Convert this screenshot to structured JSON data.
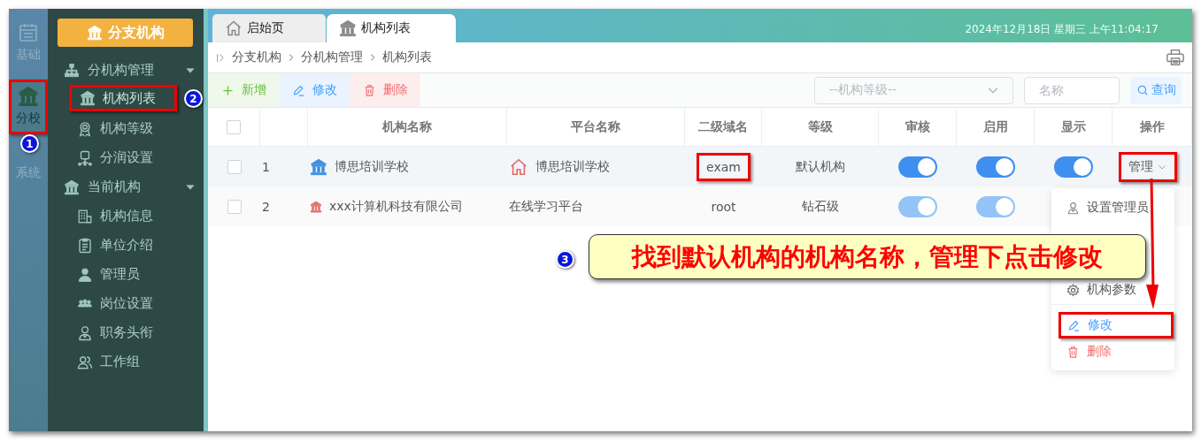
{
  "rail": [
    {
      "label": "基础",
      "selected": false,
      "highlighted": false
    },
    {
      "label": "分校",
      "selected": true,
      "highlighted": true
    },
    {
      "label": "系统",
      "selected": false,
      "highlighted": false
    }
  ],
  "sidebar": {
    "title": "分支机构",
    "groups": [
      {
        "label": "分机构管理",
        "expanded": true,
        "children": [
          {
            "label": "机构列表",
            "selected": true,
            "highlighted": true
          },
          {
            "label": "机构等级",
            "selected": false,
            "highlighted": false
          },
          {
            "label": "分润设置",
            "selected": false,
            "highlighted": false
          }
        ]
      },
      {
        "label": "当前机构",
        "expanded": true,
        "children": [
          {
            "label": "机构信息",
            "selected": false,
            "highlighted": false
          },
          {
            "label": "单位介绍",
            "selected": false,
            "highlighted": false
          },
          {
            "label": "管理员",
            "selected": false,
            "highlighted": false
          },
          {
            "label": "岗位设置",
            "selected": false,
            "highlighted": false
          },
          {
            "label": "职务头衔",
            "selected": false,
            "highlighted": false
          },
          {
            "label": "工作组",
            "selected": false,
            "highlighted": false
          }
        ]
      }
    ]
  },
  "tabs": [
    {
      "label": "启始页",
      "selected": false
    },
    {
      "label": "机构列表",
      "selected": true
    }
  ],
  "datetime": "2024年12月18日 星期三 上午11:04:17",
  "breadcrumb": [
    "分支机构",
    "分机构管理",
    "机构列表"
  ],
  "toolbar": [
    {
      "label": "新增",
      "kind": "add"
    },
    {
      "label": "修改",
      "kind": "edit"
    },
    {
      "label": "删除",
      "kind": "delete"
    }
  ],
  "filters": {
    "level_select": {
      "placeholder": "--机构等级--"
    },
    "name_field": {
      "placeholder": "名称"
    },
    "search_button": "查询"
  },
  "table": {
    "all_checked": false,
    "columns": [
      "机构名称",
      "平台名称",
      "二级域名",
      "等级",
      "审核",
      "启用",
      "显示",
      "操作"
    ],
    "rows": [
      {
        "checked": false,
        "index": "1",
        "is_default": true,
        "name": "博思培训学校",
        "platform": "博思培训学校",
        "domain": "exam",
        "domain_highlighted": true,
        "level": "默认机构",
        "audit": {
          "on": true,
          "disabled": false
        },
        "enabled": {
          "on": true,
          "disabled": false
        },
        "shown": {
          "on": true,
          "disabled": false
        },
        "action": {
          "label": "管理",
          "highlighted": true
        }
      },
      {
        "checked": false,
        "index": "2",
        "is_default": false,
        "name": "xxx计算机科技有限公司",
        "platform": "在线学习平台",
        "domain": "root",
        "domain_highlighted": false,
        "level": "钻石级",
        "audit": {
          "on": true,
          "disabled": true
        },
        "enabled": {
          "on": true,
          "disabled": true
        }
      }
    ]
  },
  "action_menu": [
    {
      "label": "设置管理员",
      "kind": "admin",
      "highlighted": false
    },
    {
      "label": "机构参数",
      "kind": "params",
      "highlighted": false
    },
    {
      "label": "修改",
      "kind": "edit",
      "highlighted": true
    },
    {
      "label": "删除",
      "kind": "delete",
      "highlighted": false
    }
  ],
  "annotations": {
    "markers": [
      "1",
      "2",
      "3"
    ],
    "callout": "找到默认机构的机构名称，管理下点击修改"
  }
}
